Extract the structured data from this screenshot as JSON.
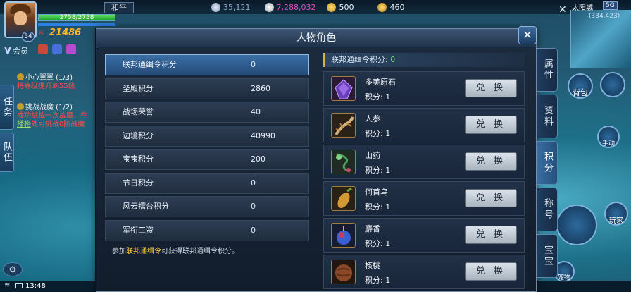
{
  "hud": {
    "hp_text": "2758/2758",
    "hp_fraction": 1.0,
    "level": "54",
    "power": "21486",
    "vip_label": "会员",
    "mode": "和平",
    "currencies": [
      {
        "icon": "silver-coin-icon",
        "value": "35,121",
        "color": "#8fa7c9"
      },
      {
        "icon": "pearl-icon",
        "value": "7,288,032",
        "color": "#d94fbf"
      },
      {
        "icon": "gold-coin-icon",
        "value": "500",
        "color": "#f5f5f5"
      },
      {
        "icon": "gold-ingot-icon",
        "value": "460",
        "color": "#f5f5f5"
      }
    ],
    "town": "太阳城",
    "ping": "5G",
    "coords": "(334,423)",
    "time": "13:48"
  },
  "quests": [
    {
      "title": "小心翼翼 (1/3)",
      "desc": "将等级提升到55级",
      "link": ""
    },
    {
      "title": "挑战战魔 (1/2)",
      "desc": "成功挑战一次战魔，在",
      "link": "播格",
      "desc2": "处可挑战0阶战魔"
    }
  ],
  "side_tabs": {
    "task": "任务",
    "team": "队伍"
  },
  "right_hud": {
    "bag": "背包",
    "auto": "手动",
    "player": "玩家",
    "pet": "宠物"
  },
  "dialog": {
    "title": "人物角色",
    "close": "✕",
    "scores": [
      {
        "name": "联邦通缉令积分",
        "value": "0"
      },
      {
        "name": "圣殿积分",
        "value": "2860"
      },
      {
        "name": "战场荣誉",
        "value": "40"
      },
      {
        "name": "边境积分",
        "value": "40990"
      },
      {
        "name": "宝宝积分",
        "value": "200"
      },
      {
        "name": "节日积分",
        "value": "0"
      },
      {
        "name": "风云擂台积分",
        "value": "0"
      },
      {
        "name": "军衔工资",
        "value": "0"
      }
    ],
    "hint_pre": "参加",
    "hint_link": "联邦通缉令",
    "hint_post": "可获得联邦通缉令积分。",
    "panel_title": "联邦通缉令积分: ",
    "panel_value": "0",
    "items": [
      {
        "name": "多美原石",
        "points": "积分: 1",
        "button": "兑 换",
        "icon": "crystal-icon",
        "color": "#6b3fb8"
      },
      {
        "name": "人参",
        "points": "积分: 1",
        "button": "兑 换",
        "icon": "ginseng-icon",
        "color": "#b07a3a"
      },
      {
        "name": "山药",
        "points": "积分: 1",
        "button": "兑 换",
        "icon": "yam-icon",
        "color": "#4aa05a"
      },
      {
        "name": "何首乌",
        "points": "积分: 1",
        "button": "兑 换",
        "icon": "fleeceflower-icon",
        "color": "#d19a35"
      },
      {
        "name": "麝香",
        "points": "积分: 1",
        "button": "兑 换",
        "icon": "musk-icon",
        "color": "#3a5fd0"
      },
      {
        "name": "核桃",
        "points": "积分: 1",
        "button": "兑 换",
        "icon": "walnut-icon",
        "color": "#8a4a2a"
      }
    ],
    "tabs": [
      {
        "label": "属性",
        "active": false
      },
      {
        "label": "资料",
        "active": false
      },
      {
        "label": "积分",
        "active": true
      },
      {
        "label": "称号",
        "active": false
      },
      {
        "label": "宝宝",
        "active": false
      }
    ]
  }
}
